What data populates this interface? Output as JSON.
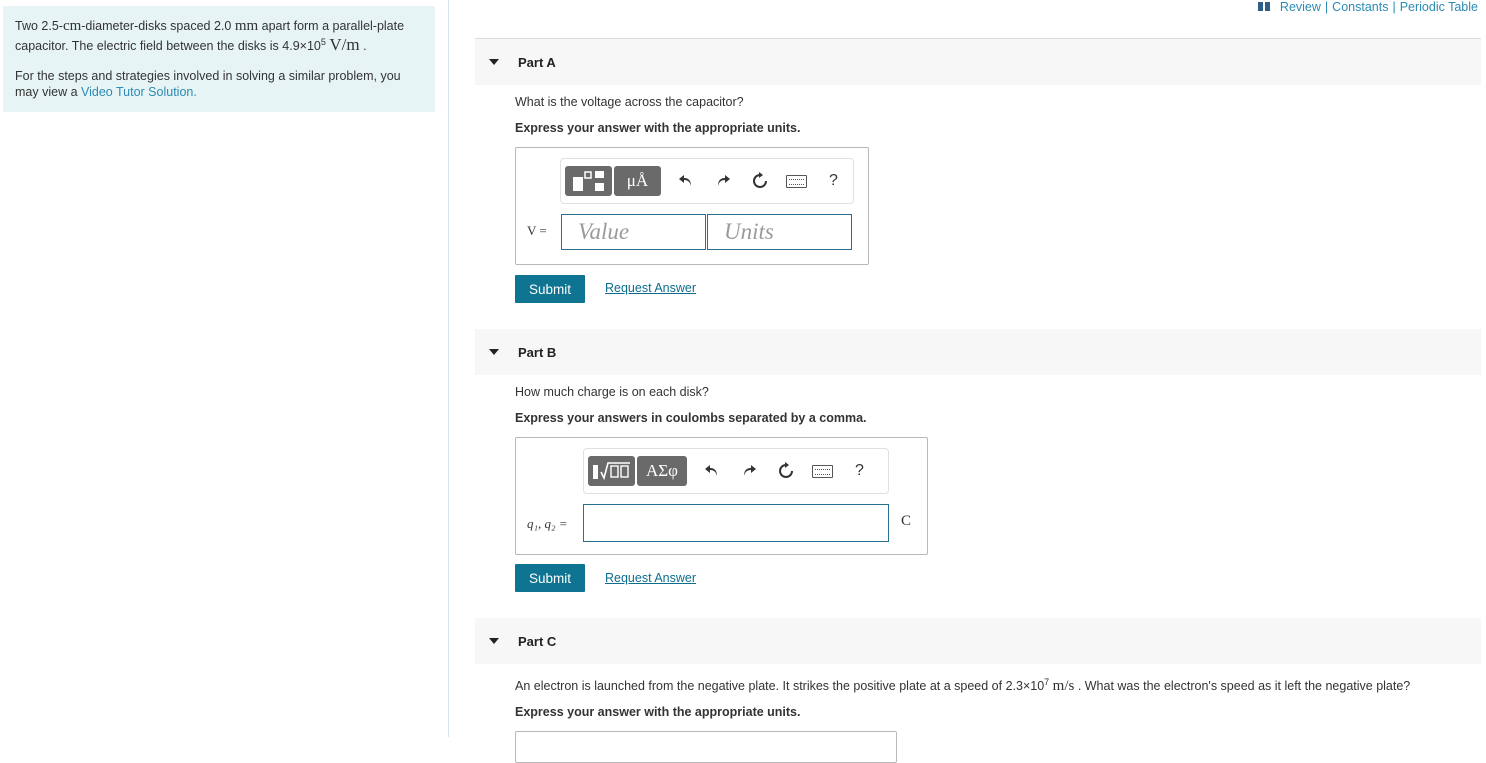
{
  "intro": {
    "p1_pre": "Two 2.5-",
    "p1_cm": "cm",
    "p1_mid1": "-diameter-disks spaced 2.0 ",
    "p1_mm": "mm",
    "p1_mid2": " apart form a parallel-plate capacitor. The electric field between the disks is 4.9×10",
    "p1_exp": "5",
    "p1_unit": "V/m",
    "p1_end": " .",
    "p2_pre": "For the steps and strategies involved in solving a similar problem, you may view a ",
    "p2_link": "Video Tutor Solution",
    "p2_end": "."
  },
  "top_links": {
    "review": "Review",
    "sep": "|",
    "constants": "Constants",
    "periodic": "Periodic Table"
  },
  "part_a": {
    "title": "Part A",
    "question": "What is the voltage across the capacitor?",
    "instruction": "Express your answer with the appropriate units.",
    "tool_units": "μÅ",
    "help": "?",
    "var_label": "V =",
    "value_placeholder": "Value",
    "units_placeholder": "Units",
    "submit": "Submit",
    "request": "Request Answer"
  },
  "part_b": {
    "title": "Part B",
    "question": "How much charge is on each disk?",
    "instruction": "Express your answers in coulombs separated by a comma.",
    "tool_symbols": "ΑΣφ",
    "help": "?",
    "var_label": "q₁, q₂ =",
    "unit": "C",
    "submit": "Submit",
    "request": "Request Answer"
  },
  "part_c": {
    "title": "Part C",
    "question_pre": "An electron is launched from the negative plate. It strikes the positive plate at a speed of 2.3×10",
    "question_exp": "7",
    "question_unit": "m/s",
    "question_end": " . What was the electron's speed as it left the negative plate?",
    "instruction": "Express your answer with the appropriate units."
  }
}
